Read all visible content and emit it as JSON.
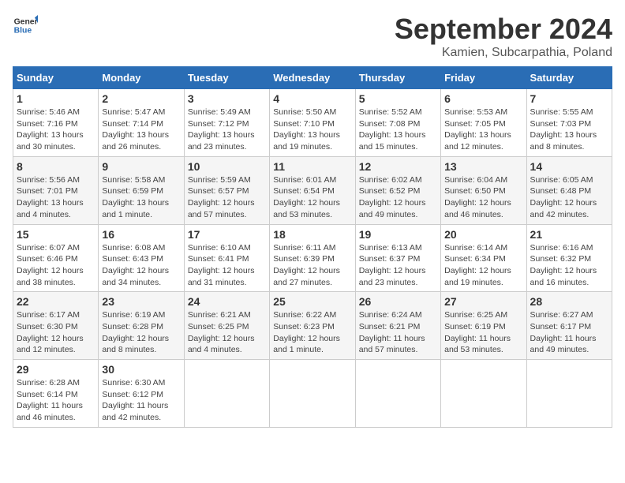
{
  "header": {
    "logo_general": "General",
    "logo_blue": "Blue",
    "title": "September 2024",
    "subtitle": "Kamien, Subcarpathia, Poland"
  },
  "weekdays": [
    "Sunday",
    "Monday",
    "Tuesday",
    "Wednesday",
    "Thursday",
    "Friday",
    "Saturday"
  ],
  "weeks": [
    [
      {
        "day": "1",
        "info": "Sunrise: 5:46 AM\nSunset: 7:16 PM\nDaylight: 13 hours\nand 30 minutes."
      },
      {
        "day": "2",
        "info": "Sunrise: 5:47 AM\nSunset: 7:14 PM\nDaylight: 13 hours\nand 26 minutes."
      },
      {
        "day": "3",
        "info": "Sunrise: 5:49 AM\nSunset: 7:12 PM\nDaylight: 13 hours\nand 23 minutes."
      },
      {
        "day": "4",
        "info": "Sunrise: 5:50 AM\nSunset: 7:10 PM\nDaylight: 13 hours\nand 19 minutes."
      },
      {
        "day": "5",
        "info": "Sunrise: 5:52 AM\nSunset: 7:08 PM\nDaylight: 13 hours\nand 15 minutes."
      },
      {
        "day": "6",
        "info": "Sunrise: 5:53 AM\nSunset: 7:05 PM\nDaylight: 13 hours\nand 12 minutes."
      },
      {
        "day": "7",
        "info": "Sunrise: 5:55 AM\nSunset: 7:03 PM\nDaylight: 13 hours\nand 8 minutes."
      }
    ],
    [
      {
        "day": "8",
        "info": "Sunrise: 5:56 AM\nSunset: 7:01 PM\nDaylight: 13 hours\nand 4 minutes."
      },
      {
        "day": "9",
        "info": "Sunrise: 5:58 AM\nSunset: 6:59 PM\nDaylight: 13 hours\nand 1 minute."
      },
      {
        "day": "10",
        "info": "Sunrise: 5:59 AM\nSunset: 6:57 PM\nDaylight: 12 hours\nand 57 minutes."
      },
      {
        "day": "11",
        "info": "Sunrise: 6:01 AM\nSunset: 6:54 PM\nDaylight: 12 hours\nand 53 minutes."
      },
      {
        "day": "12",
        "info": "Sunrise: 6:02 AM\nSunset: 6:52 PM\nDaylight: 12 hours\nand 49 minutes."
      },
      {
        "day": "13",
        "info": "Sunrise: 6:04 AM\nSunset: 6:50 PM\nDaylight: 12 hours\nand 46 minutes."
      },
      {
        "day": "14",
        "info": "Sunrise: 6:05 AM\nSunset: 6:48 PM\nDaylight: 12 hours\nand 42 minutes."
      }
    ],
    [
      {
        "day": "15",
        "info": "Sunrise: 6:07 AM\nSunset: 6:46 PM\nDaylight: 12 hours\nand 38 minutes."
      },
      {
        "day": "16",
        "info": "Sunrise: 6:08 AM\nSunset: 6:43 PM\nDaylight: 12 hours\nand 34 minutes."
      },
      {
        "day": "17",
        "info": "Sunrise: 6:10 AM\nSunset: 6:41 PM\nDaylight: 12 hours\nand 31 minutes."
      },
      {
        "day": "18",
        "info": "Sunrise: 6:11 AM\nSunset: 6:39 PM\nDaylight: 12 hours\nand 27 minutes."
      },
      {
        "day": "19",
        "info": "Sunrise: 6:13 AM\nSunset: 6:37 PM\nDaylight: 12 hours\nand 23 minutes."
      },
      {
        "day": "20",
        "info": "Sunrise: 6:14 AM\nSunset: 6:34 PM\nDaylight: 12 hours\nand 19 minutes."
      },
      {
        "day": "21",
        "info": "Sunrise: 6:16 AM\nSunset: 6:32 PM\nDaylight: 12 hours\nand 16 minutes."
      }
    ],
    [
      {
        "day": "22",
        "info": "Sunrise: 6:17 AM\nSunset: 6:30 PM\nDaylight: 12 hours\nand 12 minutes."
      },
      {
        "day": "23",
        "info": "Sunrise: 6:19 AM\nSunset: 6:28 PM\nDaylight: 12 hours\nand 8 minutes."
      },
      {
        "day": "24",
        "info": "Sunrise: 6:21 AM\nSunset: 6:25 PM\nDaylight: 12 hours\nand 4 minutes."
      },
      {
        "day": "25",
        "info": "Sunrise: 6:22 AM\nSunset: 6:23 PM\nDaylight: 12 hours\nand 1 minute."
      },
      {
        "day": "26",
        "info": "Sunrise: 6:24 AM\nSunset: 6:21 PM\nDaylight: 11 hours\nand 57 minutes."
      },
      {
        "day": "27",
        "info": "Sunrise: 6:25 AM\nSunset: 6:19 PM\nDaylight: 11 hours\nand 53 minutes."
      },
      {
        "day": "28",
        "info": "Sunrise: 6:27 AM\nSunset: 6:17 PM\nDaylight: 11 hours\nand 49 minutes."
      }
    ],
    [
      {
        "day": "29",
        "info": "Sunrise: 6:28 AM\nSunset: 6:14 PM\nDaylight: 11 hours\nand 46 minutes."
      },
      {
        "day": "30",
        "info": "Sunrise: 6:30 AM\nSunset: 6:12 PM\nDaylight: 11 hours\nand 42 minutes."
      },
      {
        "day": "",
        "info": ""
      },
      {
        "day": "",
        "info": ""
      },
      {
        "day": "",
        "info": ""
      },
      {
        "day": "",
        "info": ""
      },
      {
        "day": "",
        "info": ""
      }
    ]
  ]
}
